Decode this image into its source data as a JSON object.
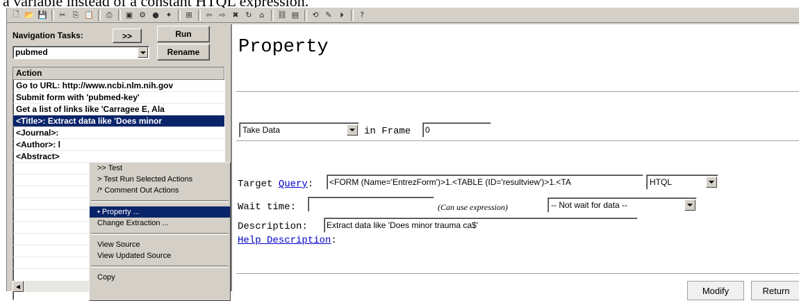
{
  "caption": "a variable instead of a constant HTQL expression.",
  "toolbar": {
    "icons": [
      "new-icon",
      "open-icon",
      "save-icon",
      "cut-icon",
      "copy-icon",
      "paste-icon",
      "print-icon",
      "window-icon",
      "run-icon",
      "record-icon",
      "wizard-icon",
      "extract-icon",
      "back-icon",
      "forward-icon",
      "stop-icon",
      "refresh-icon",
      "home-icon",
      "link-icon",
      "data-icon",
      "prev-icon",
      "pen-icon",
      "play-icon",
      "help-icon"
    ]
  },
  "left": {
    "nav_label": "Navigation Tasks:",
    "nav_arrows": ">>",
    "run": "Run",
    "rename": "Rename",
    "task_select": "pubmed",
    "list_header": "Action",
    "rows": [
      "Go to URL: http://www.ncbi.nlm.nih.gov",
      "Submit form with 'pubmed-key'",
      "Get a list of links like 'Carragee E, Ala",
      "<Title>: Extract data like 'Does minor",
      "<Journal>:",
      "<Author>: l",
      "<Abstract>"
    ]
  },
  "context_menu": {
    "items": [
      {
        "label": ">> Test"
      },
      {
        "label": "> Test Run Selected Actions"
      },
      {
        "label": "/* Comment Out Actions"
      },
      {
        "sep": true
      },
      {
        "label": "• Property ...",
        "highlight": true
      },
      {
        "label": "Change Extraction ..."
      },
      {
        "sep": true
      },
      {
        "label": "View Source"
      },
      {
        "label": "View Updated Source"
      },
      {
        "sep": true
      },
      {
        "label": "Copy"
      }
    ]
  },
  "right": {
    "title": "Property",
    "action_select": "Take Data",
    "in_frame_label": "in Frame",
    "frame_value": "0",
    "target_label": "Target",
    "query_link": "Query",
    "target_colon": ":",
    "query_value": "<FORM (Name='EntrezForm')>1.<TABLE (ID='resultview')>1.<TA",
    "query_lang": "HTQL",
    "wait_label": "Wait time:",
    "wait_value": "",
    "wait_hint": "(Can use expression)",
    "wait_select": "-- Not wait for data --",
    "desc_label": "Description:",
    "desc_value": "Extract data like 'Does minor trauma ca$'",
    "help_link": "Help Description",
    "help_colon": ":",
    "modify": "Modify",
    "return": "Return"
  }
}
